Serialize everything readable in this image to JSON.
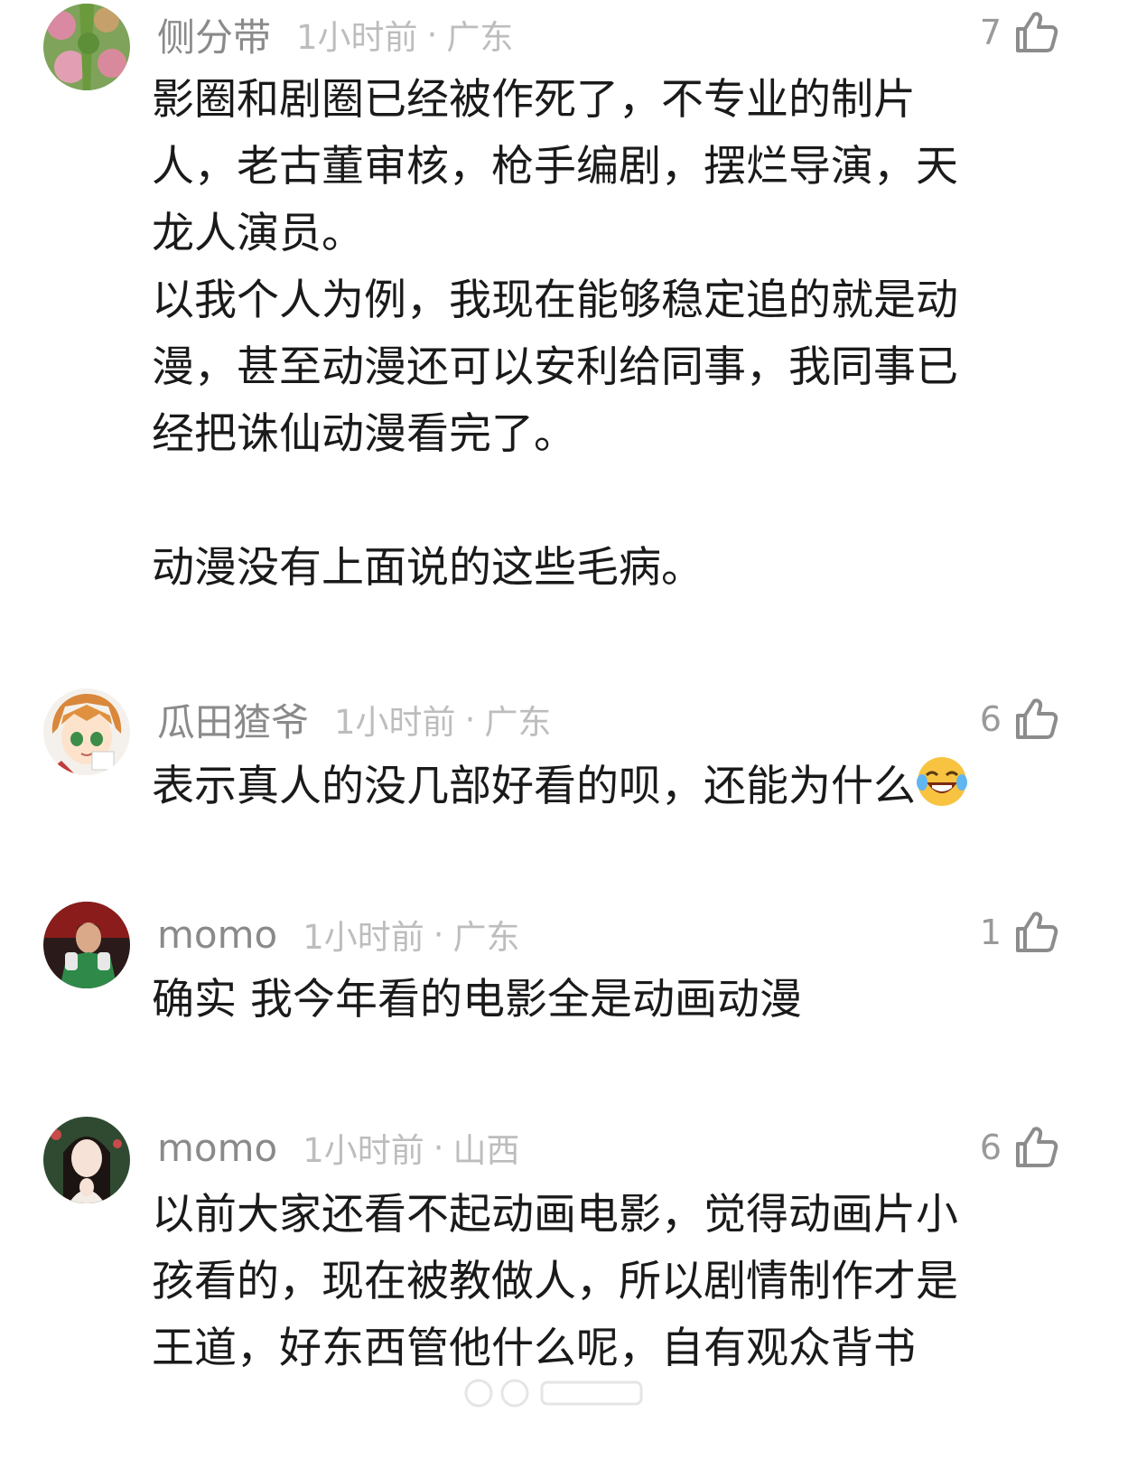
{
  "comments": [
    {
      "username": "侧分带",
      "time": "1小时前",
      "separator": "·",
      "location": "广东",
      "likes": "7",
      "avatar_icon": "flower-field-avatar",
      "lines": [
        "影圈和剧圈已经被作死了，不专业的制片",
        "人，老古董审核，枪手编剧，摆烂导演，天",
        "龙人演员。",
        "以我个人为例，我现在能够稳定追的就是动",
        "漫，甚至动漫还可以安利给同事，我同事已",
        "经把诛仙动漫看完了。",
        "",
        "动漫没有上面说的这些毛病。"
      ]
    },
    {
      "username": "瓜田猹爷",
      "time": "1小时前",
      "separator": "·",
      "location": "广东",
      "likes": "6",
      "avatar_icon": "anime-girl-avatar",
      "lines": [
        "表示真人的没几部好看的呗，还能为什么"
      ],
      "emoji": "laughing-crying-emoji"
    },
    {
      "username": "momo",
      "time": "1小时前",
      "separator": "·",
      "location": "广东",
      "likes": "1",
      "avatar_icon": "goalkeeper-avatar",
      "lines": [
        "确实 我今年看的电影全是动画动漫"
      ]
    },
    {
      "username": "momo",
      "time": "1小时前",
      "separator": "·",
      "location": "山西",
      "likes": "6",
      "avatar_icon": "woman-portrait-avatar",
      "lines": [
        "以前大家还看不起动画电影，觉得动画片小",
        "孩看的，现在被教做人，所以剧情制作才是",
        "王道，好东西管他什么呢，自有观众背书"
      ]
    }
  ],
  "icons": {
    "like": "thumbs-up-icon"
  },
  "colors": {
    "username": "#8a8a8a",
    "meta": "#bdbdbd",
    "text": "#1a1a1a",
    "like": "#9a9a9a"
  }
}
